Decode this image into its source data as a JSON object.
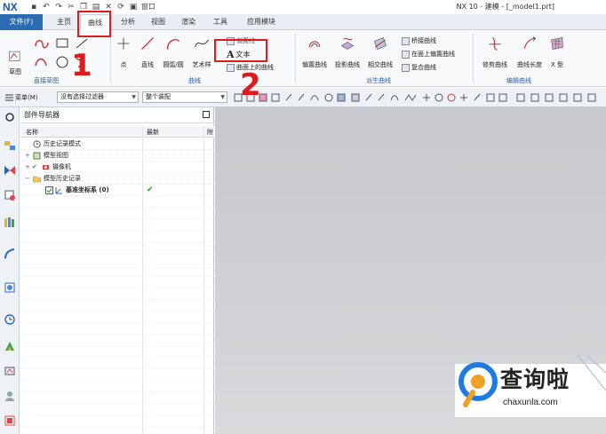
{
  "app": {
    "logo": "NX",
    "title": "NX 10 - 建模 - [_model1.prt]",
    "window_menu": "窗口"
  },
  "tabs": [
    "文件(F)",
    "主页",
    "曲线",
    "分析",
    "视图",
    "渲染",
    "工具",
    "应用模块"
  ],
  "active_tab": "曲线",
  "ribbon": {
    "sketch_group": {
      "label": "直接草图",
      "sketch_button": "草图"
    },
    "curve_group": {
      "label": "曲线",
      "point": "点",
      "line": "直线",
      "arc": "圆弧/圆",
      "spline": "艺术样",
      "small_items": [
        "偏置线",
        "文本",
        "曲面上的曲线"
      ]
    },
    "derived_group": {
      "label": "派生曲线",
      "offset": "偏置曲线",
      "project": "投影曲线",
      "intersect": "相交曲线",
      "small_items": [
        "桥接曲线",
        "在面上偏置曲线",
        "复合曲线"
      ]
    },
    "edit_group": {
      "label": "编辑曲线",
      "trim": "修剪曲线",
      "length": "曲线长度",
      "x": "X 型"
    }
  },
  "toolbar": {
    "menu": "菜单(M)",
    "filter": "没有选择过滤器",
    "assembly": "整个装配"
  },
  "navigator": {
    "title": "部件导航器",
    "col_name": "名称",
    "col_latest": "最新",
    "col_extra": "附",
    "rows": [
      {
        "label": "历史记录模式"
      },
      {
        "label": "模型视图"
      },
      {
        "label": "摄像机"
      },
      {
        "label": "模型历史记录"
      },
      {
        "label": "基准坐标系 (0)",
        "latest": "✔"
      }
    ]
  },
  "annotations": {
    "step1": "1",
    "step2": "2"
  },
  "watermark": {
    "text": "查询啦",
    "url": "chaxunla.com"
  },
  "colors": {
    "file_tab": "#2a6bb2",
    "annotation": "#e0191c",
    "check": "#2aa52a"
  }
}
